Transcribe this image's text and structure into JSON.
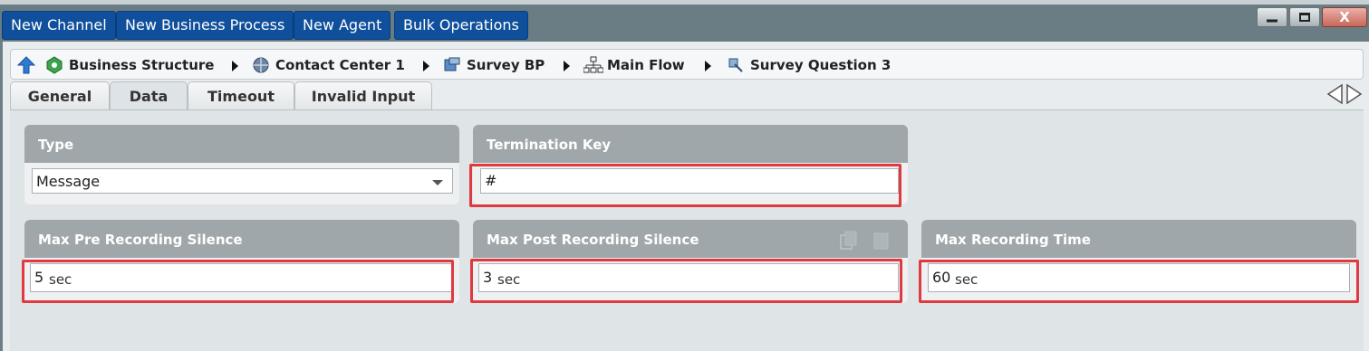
{
  "toolbar": {
    "buttons": [
      "New Channel",
      "New Business Process",
      "New Agent",
      "Bulk Operations"
    ],
    "window_controls": [
      "minimize-icon",
      "restore-icon",
      "close-icon"
    ],
    "close_glyph": "X"
  },
  "breadcrumb": {
    "items": [
      {
        "label": "Business Structure",
        "icon": "business-structure-icon"
      },
      {
        "label": "Contact Center 1",
        "icon": "contact-center-icon"
      },
      {
        "label": "Survey BP",
        "icon": "business-process-icon"
      },
      {
        "label": "Main Flow",
        "icon": "flow-icon"
      },
      {
        "label": "Survey Question 3",
        "icon": "survey-question-icon"
      }
    ]
  },
  "tabs": [
    {
      "label": "General",
      "active": false
    },
    {
      "label": "Data",
      "active": true
    },
    {
      "label": "Timeout",
      "active": false
    },
    {
      "label": "Invalid Input",
      "active": false
    }
  ],
  "fields": {
    "type": {
      "label": "Type",
      "value": "Message"
    },
    "termination_key": {
      "label": "Termination Key",
      "value": "#"
    },
    "max_pre": {
      "label": "Max Pre Recording Silence",
      "value": "5",
      "unit": "sec"
    },
    "max_post": {
      "label": "Max Post Recording Silence",
      "value": "3",
      "unit": "sec"
    },
    "max_time": {
      "label": "Max Recording Time",
      "value": "60",
      "unit": "sec"
    }
  },
  "colors": {
    "toolbar_button": "#0f4f9b",
    "highlight": "#e0393f",
    "card_header": "#a0a7aa"
  }
}
